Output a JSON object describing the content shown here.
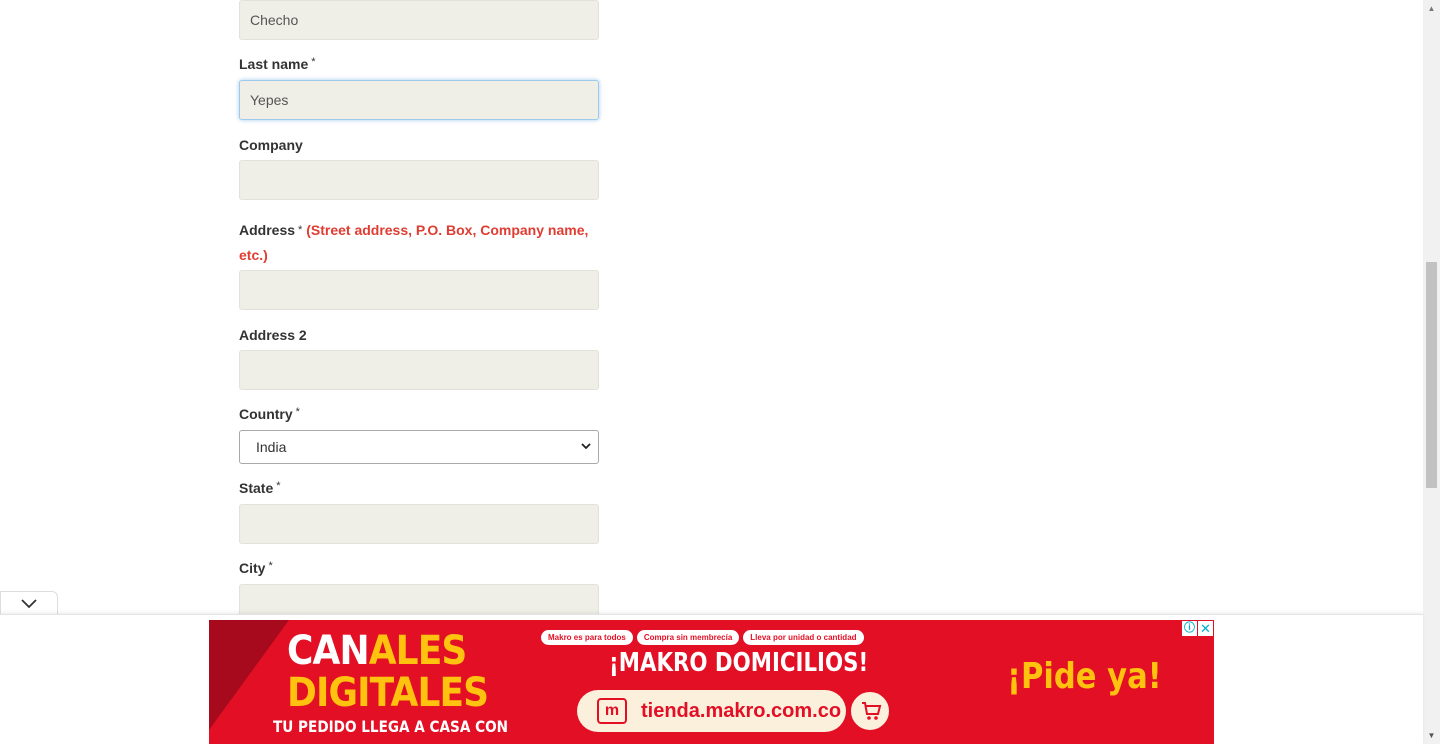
{
  "form": {
    "first_name": {
      "value": "Checho"
    },
    "last_name": {
      "label": "Last name",
      "required_mark": "*",
      "value": "Yepes"
    },
    "company": {
      "label": "Company",
      "value": ""
    },
    "address": {
      "label": "Address",
      "required_mark": "*",
      "hint": "(Street address, P.O. Box, Company name, etc.)",
      "value": ""
    },
    "address2": {
      "label": "Address 2",
      "value": ""
    },
    "country": {
      "label": "Country",
      "required_mark": "*",
      "selected": "India"
    },
    "state": {
      "label": "State",
      "required_mark": "*",
      "value": ""
    },
    "city": {
      "label": "City",
      "required_mark": "*",
      "value": ""
    }
  },
  "ad": {
    "title_line1_white": "CAN",
    "title_line1_yellow": "ALES",
    "title_line2_yellow": "DIGIT",
    "title_line2_rest": "ALES",
    "subtitle": "TU PEDIDO LLEGA A CASA CON",
    "pills": [
      "Makro es para todos",
      "Compra sin membrecía",
      "Lleva por unidad o cantidad"
    ],
    "headline": "¡MAKRO DOMICILIOS!",
    "url_icon": "m",
    "url": "tienda.makro.com.co",
    "cta": "¡Pide ya!",
    "info_icon": "ⓘ",
    "close_icon": "✕"
  },
  "colors": {
    "ad_red": "#e30f25",
    "ad_yellow": "#ffc20e",
    "hint_red": "#e03c31",
    "input_bg": "#efefe8"
  }
}
